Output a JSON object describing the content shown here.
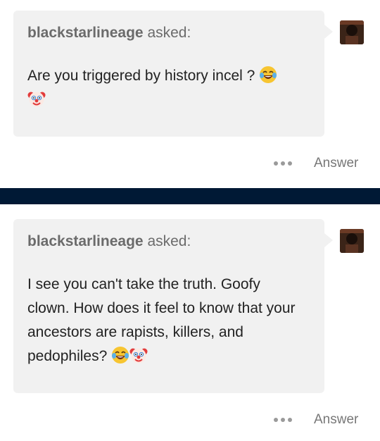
{
  "posts": [
    {
      "asker": "blackstarlineage",
      "asked_label": "asked:",
      "question_text": "Are you triggered by history incel ?",
      "emojis": [
        "laughing-crying-emoji",
        "clown-emoji"
      ],
      "answer_label": "Answer"
    },
    {
      "asker": "blackstarlineage",
      "asked_label": "asked:",
      "question_text": "I see you can't take the truth. Goofy clown. How does it feel to know that your ancestors are rapists, killers, and pedophiles?",
      "emojis": [
        "laughing-crying-emoji",
        "clown-emoji"
      ],
      "answer_label": "Answer"
    }
  ],
  "colors": {
    "bubble": "#f1f1f1",
    "divider": "#001935",
    "asker_text": "#6b6b6b",
    "question_text": "#222222"
  }
}
